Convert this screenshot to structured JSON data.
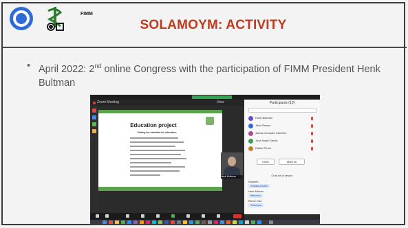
{
  "slide": {
    "title": "SOLAMOYM: ACTIVITY",
    "logo_text": "FIMM",
    "bullet": {
      "prefix": "April 2022: 2",
      "sup": "nd",
      "rest": " online Congress with the participation of FIMM President Henk Bultman"
    }
  },
  "screenshot": {
    "zoom_meeting_label": "Zoom Meeting",
    "view_label": "View",
    "shared_title": "Education project",
    "shared_subtitle": "Setting the standard for education",
    "speaker_name": "Henk Bultman",
    "panel_title": "Participants (10)",
    "participants": [
      {
        "name": "Henk Bultman",
        "color": "#6d4bc2"
      },
      {
        "name": "Jose Ramon",
        "color": "#2f6bd6"
      },
      {
        "name": "Juana Gonzalez Sanchez",
        "color": "#b04a8f"
      },
      {
        "name": "Jose Angel Garcia",
        "color": "#3a9a58"
      },
      {
        "name": "Rafael Perez",
        "color": "#c97c2a"
      }
    ],
    "invite_label": "Invite",
    "mute_all_label": "Mute all",
    "chat_title": "Chat de la sesion",
    "chat_messages": [
      {
        "from": "Elizabeth",
        "text": "Gracias a todos"
      },
      {
        "from": "Henk Bultman",
        "text": "Welcome"
      },
      {
        "from": "Ramon Diaz",
        "text": "Thank you"
      }
    ],
    "end_label": "End"
  }
}
